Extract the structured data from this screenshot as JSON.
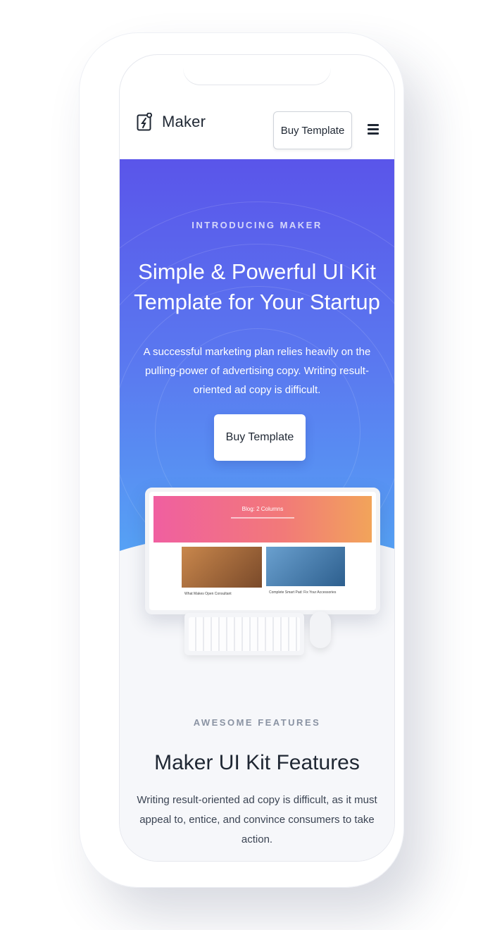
{
  "navbar": {
    "brand": "Maker",
    "buy_button": "Buy Template",
    "menu_icon": "hamburger-icon",
    "logo_icon": "maker-logo-icon"
  },
  "hero": {
    "eyebrow": "INTRODUCING MAKER",
    "title": "Simple & Powerful UI Kit Template for Your Startup",
    "subtitle": "A successful marketing plan relies heavily on the pulling-power of advertising copy. Writing result-oriented ad copy is difficult.",
    "cta_button": "Buy Template",
    "gradient_colors": [
      "#5a55ea",
      "#56a2f5"
    ]
  },
  "mockup": {
    "banner_title": "Blog: 2 Columns",
    "card1_caption": "What Makes Open Consultant",
    "card2_caption": "Complete Smart Pad: Fix Your Accessories"
  },
  "features": {
    "eyebrow": "AWESOME FEATURES",
    "title": "Maker UI Kit Features",
    "subtitle": "Writing result-oriented ad copy is difficult, as it must appeal to, entice, and convince consumers to take action."
  }
}
